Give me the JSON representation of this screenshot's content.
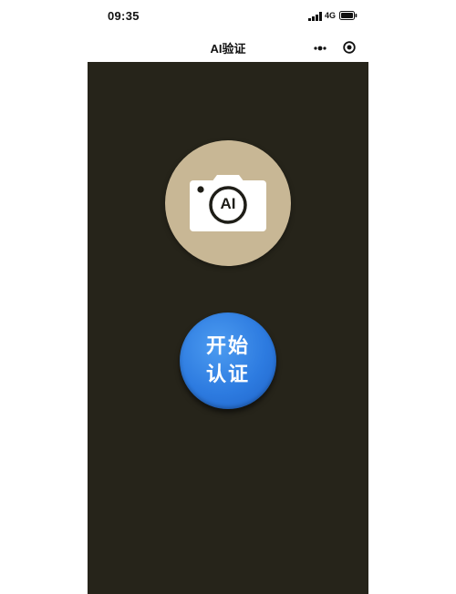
{
  "status_bar": {
    "time": "09:35",
    "network": "4G",
    "icons": [
      "signal-icon",
      "battery-icon"
    ]
  },
  "nav": {
    "title": "AI验证",
    "icons": [
      "more-icon",
      "target-icon"
    ]
  },
  "camera": {
    "icon": "camera-icon",
    "label": "AI",
    "circle_color": "#c8b795"
  },
  "start_button": {
    "line1": "开始",
    "line2": "认证",
    "color": "#2d7be0"
  },
  "colors": {
    "panel_background": "#26241a",
    "page_background": "#ffffff"
  }
}
